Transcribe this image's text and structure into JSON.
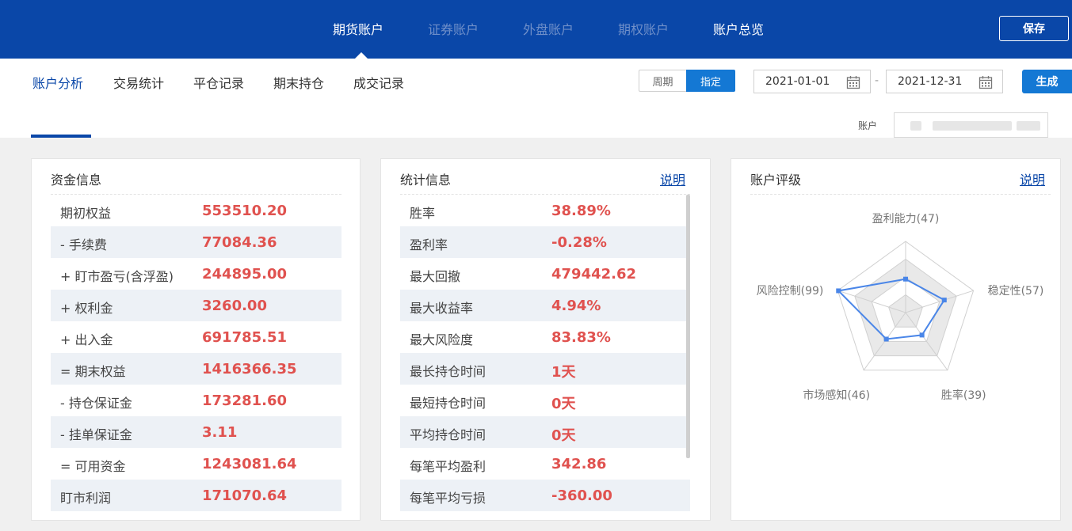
{
  "top_nav": {
    "tabs": [
      {
        "label": "期货账户",
        "state": "active"
      },
      {
        "label": "证券账户",
        "state": "dim"
      },
      {
        "label": "外盘账户",
        "state": "dim"
      },
      {
        "label": "期权账户",
        "state": "dim"
      },
      {
        "label": "账户总览",
        "state": "bright"
      }
    ],
    "save_label": "保存"
  },
  "sub_nav": {
    "tabs": [
      "账户分析",
      "交易统计",
      "平仓记录",
      "期末持仓",
      "成交记录"
    ],
    "active_index": 0
  },
  "toolbar": {
    "period_label": "周期",
    "custom_label": "指定",
    "start_date": "2021-01-01",
    "end_date": "2021-12-31",
    "separator": "-",
    "generate_label": "生成",
    "account_label": "账户"
  },
  "fund_panel": {
    "title": "资金信息",
    "rows": [
      {
        "label": "期初权益",
        "value": "553510.20"
      },
      {
        "label": "-  手续费",
        "value": "77084.36"
      },
      {
        "label": "+ 盯市盈亏(含浮盈)",
        "value": "244895.00"
      },
      {
        "label": "+ 权利金",
        "value": "3260.00"
      },
      {
        "label": "+ 出入金",
        "value": "691785.51"
      },
      {
        "label": "= 期末权益",
        "value": "1416366.35"
      },
      {
        "label": "-  持仓保证金",
        "value": "173281.60"
      },
      {
        "label": "-  挂单保证金",
        "value": "3.11"
      },
      {
        "label": "= 可用资金",
        "value": "1243081.64"
      },
      {
        "label": "盯市利润",
        "value": "171070.64"
      }
    ]
  },
  "stats_panel": {
    "title": "统计信息",
    "link": "说明",
    "rows": [
      {
        "label": "胜率",
        "value": "38.89%"
      },
      {
        "label": "盈利率",
        "value": "-0.28%"
      },
      {
        "label": "最大回撤",
        "value": "479442.62"
      },
      {
        "label": "最大收益率",
        "value": "4.94%"
      },
      {
        "label": "最大风险度",
        "value": "83.83%"
      },
      {
        "label": "最长持仓时间",
        "value": "1天"
      },
      {
        "label": "最短持仓时间",
        "value": "0天"
      },
      {
        "label": "平均持仓时间",
        "value": "0天"
      },
      {
        "label": "每笔平均盈利",
        "value": "342.86"
      },
      {
        "label": "每笔平均亏损",
        "value": "-360.00"
      }
    ]
  },
  "rating_panel": {
    "title": "账户评级",
    "link": "说明"
  },
  "chart_data": {
    "type": "radar",
    "max": 100,
    "axes": [
      {
        "name": "盈利能力",
        "value": 47,
        "label": "盈利能力(47)"
      },
      {
        "name": "稳定性",
        "value": 57,
        "label": "稳定性(57)"
      },
      {
        "name": "胜率",
        "value": 39,
        "label": "胜率(39)"
      },
      {
        "name": "市场感知",
        "value": 46,
        "label": "市场感知(46)"
      },
      {
        "name": "风险控制",
        "value": 99,
        "label": "风险控制(99)"
      }
    ],
    "line_color": "#4a86e8",
    "grid_levels": 4
  },
  "colors": {
    "brand": "#0a47a8",
    "accent": "#1478d4",
    "value_red": "#e0524f"
  }
}
